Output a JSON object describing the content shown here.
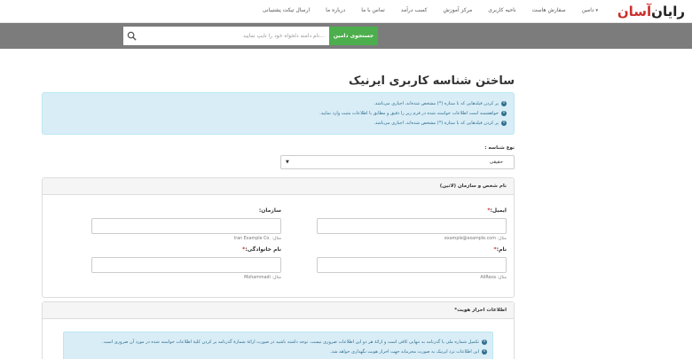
{
  "header": {
    "logo_part1": "آسان",
    "logo_part2": "رایان",
    "menu": [
      {
        "label": "دامین",
        "has_caret": true
      },
      {
        "label": "سفارش هاست"
      },
      {
        "label": "ناحیه کاربری"
      },
      {
        "label": "مرکز آموزش"
      },
      {
        "label": "کسب درآمد"
      },
      {
        "label": "تماس با ما"
      },
      {
        "label": "درباره ما"
      },
      {
        "label": "ارسال تیکت پشتیبانی"
      }
    ]
  },
  "search": {
    "placeholder": "...نام دامنه دلخواه خود را تایپ نمایید",
    "button_label": "جستجوی دامین",
    "icon": "search-icon"
  },
  "page": {
    "title": "ساختن شناسه کاربری ایرنیک",
    "info_lines": [
      "پر کردن فیلدهایی که با ستاره (*) مشخص شده‌اند، اجباری می‌باشد.",
      "خواهشمند است اطلاعات خواسته شده در فرم زیر را دقیق و مطابق با اطلاعات مثبت وارد نمایید.",
      "پر کردن فیلدهایی که با ستاره (*) مشخص شده‌اند، اجباری می‌باشد."
    ],
    "type_label": "نوع شناسه :",
    "type_value": "حقیقی"
  },
  "panel_person": {
    "title": "نام شخص و سازمان (لاتین)",
    "email": {
      "label": "ایمیل:",
      "required": "*",
      "hint": "مثال: example@example.com"
    },
    "org": {
      "label": "سازمان:",
      "hint": "مثال: .Iran Example Co"
    },
    "first_name": {
      "label": "نام:",
      "required": "*",
      "hint": "مثال: AliReza"
    },
    "last_name": {
      "label": "نام خانوادگی:",
      "required": "*",
      "hint": "مثال: Mohammadi"
    }
  },
  "panel_identity": {
    "title": "اطلاعات احراز هویت*",
    "lines": [
      "تکمیل شماره ملی یا گذرنامه به تنهایی کافی است و ارائهٔ هر دو این اطلاعات ضروری نیست. توجه داشته باشید در صورت ارائهٔ شمارهٔ گذرنامه پر کردن کلیهٔ اطلاعات خواسته شده در مورد آن ضروری است.",
      "این اطلاعات نزد ایرنیک به صورت محرمانه جهت احراز هویت نگهداری خواهد شد."
    ]
  },
  "colors": {
    "search_button": "#4cae4c",
    "search_bar": "#7c7c7c",
    "info_bg": "#d9edf7",
    "info_text": "#31708f",
    "logo_red": "#c9302c"
  }
}
